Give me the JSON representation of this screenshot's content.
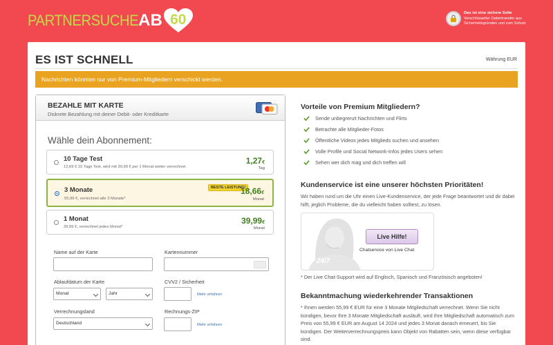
{
  "header": {
    "logo_word": "PARTNERSUCHE",
    "logo_ab": "AB",
    "logo_num": "60",
    "secure_title": "Das ist eine sichere Seite",
    "secure_sub": "Verschlüsselter Datentransfer aus Sicherheitsgründen und zum Schutz"
  },
  "page": {
    "title": "ES IST SCHNELL",
    "currency": "Währung EUR",
    "warning": "Nachrichten könnten nur von Premium-Mitgliedern verschickt werden."
  },
  "payment": {
    "title": "BEZAHLE MIT KARTE",
    "subtitle": "Diskrete Bezahlung mit deiner Debit- oder Kreditkarte",
    "choose": "Wähle dein Abonnement:",
    "plans": [
      {
        "name": "10 Tage Test",
        "desc": "12,69 € 10 Tage Test, wird mit 39,99 € per 1 Monat weiter verrechnet",
        "price": "1,27",
        "currency": "€",
        "unit": "Tag",
        "selected": false
      },
      {
        "name": "3 Monate",
        "desc": "55,99 €, verrechnet alle 3 Monate*",
        "price": "18,66",
        "currency": "€",
        "unit": "Monat",
        "selected": true,
        "badge": "BESTE LEISTUNG!"
      },
      {
        "name": "1 Monat",
        "desc": "39,99 €, verrechnet jedes Monat*",
        "price": "39,99",
        "currency": "€",
        "unit": "Monat",
        "selected": false
      }
    ],
    "form": {
      "name_label": "Name auf der Karte",
      "name_value": "",
      "number_label": "Kartennummer",
      "number_value": "",
      "expiry_label": "Ablaufdatum der Karte",
      "month_value": "Monat",
      "year_value": "Jahr",
      "cvv_label": "CVV2 / Sicherheit",
      "cvv_more": "Mehr erfahren",
      "country_label": "Verrechnungsland",
      "country_value": "Deutschland",
      "zip_label": "Rechnungs-ZIP",
      "zip_more": "Mehr erfahren"
    }
  },
  "benefits": {
    "title": "Vorteile von Premium Mitgliedern?",
    "items": [
      "Sende unbegrenzt Nachrichten und Flirts",
      "Betrachte alle Mitglieder-Fotos",
      "Öffentliche Videos jedes Mitglieds suchen und ansehen",
      "Volle Profile und Social Network-Infos jedes Users sehen",
      "Sehen wer dich mag und dich treffen will"
    ]
  },
  "support": {
    "title": "Kundenservice ist eine unserer höchsten Prioritäten!",
    "text": "Wir haben rund um die Uhr einen Live-Kundenservice, der jede Frage beantwortet und dir dabei hilft, jeglich Probleme, die du vielleicht haben solltest, zu lösen.",
    "button": "Live Hilfe!",
    "chat_sub": "Chatservice von Live Chat",
    "badge": "24/7",
    "note": "* Der Live Chat-Support wird auf Englisch, Spanisch und Französisch angeboten!"
  },
  "notice": {
    "title": "Bekanntmachung wiederkehrender Transaktionen",
    "text": "* Ihnen werden 55,99 € EUR für eine 3 Monate Mitgliedschaft verrechnet. Wenn Sie nicht kündigen, bevor Ihre 3 Monate Mitgliedschaft ausläuft, wird Ihre Mitgliedschaft automatisch zum Preis von 55,99 € EUR am August 14 2024 und jedes 3 Monat danach erneuert, bis Sie kündigen. Der Weiterverrechnungspreis kann Objekt von Rabatten sein, wenn diese verfügbar sind."
  },
  "colors": {
    "background": "#f2484f",
    "warning": "#e9a320",
    "price_green": "#3f7f1e",
    "selected_border": "#8cb440",
    "badge_yellow": "#f2d32e"
  }
}
